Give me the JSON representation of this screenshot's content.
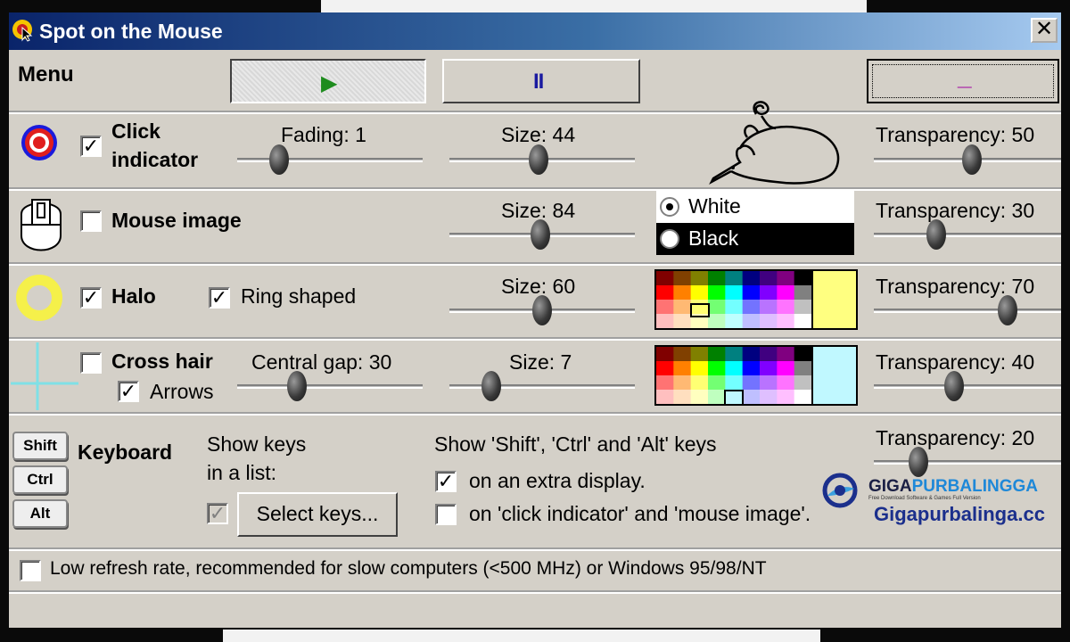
{
  "window": {
    "title": "Spot on the Mouse",
    "close_glyph": "✕"
  },
  "menu": {
    "label": "Menu",
    "play_glyph": "▶",
    "pause_glyph": "II",
    "minimize_glyph": "_"
  },
  "click_indicator": {
    "checked": true,
    "label_line1": "Click",
    "label_line2": "indicator",
    "fading_label": "Fading: 1",
    "fading_value": 1,
    "size_label": "Size: 44",
    "size_value": 44,
    "transparency_label": "Transparency: 50",
    "transparency_value": 50
  },
  "mouse_image": {
    "checked": false,
    "label": "Mouse image",
    "size_label": "Size: 84",
    "size_value": 84,
    "options": [
      "White",
      "Black"
    ],
    "selected": "White",
    "transparency_label": "Transparency: 30",
    "transparency_value": 30
  },
  "halo": {
    "checked": true,
    "label": "Halo",
    "ring_checked": true,
    "ring_label": "Ring shaped",
    "size_label": "Size: 60",
    "size_value": 60,
    "color": "#ffff80",
    "transparency_label": "Transparency: 70",
    "transparency_value": 70
  },
  "cross_hair": {
    "checked": false,
    "label": "Cross hair",
    "arrows_checked": true,
    "arrows_label": "Arrows",
    "gap_label": "Central gap: 30",
    "gap_value": 30,
    "size_label": "Size: 7",
    "size_value": 7,
    "color": "#c0f8ff",
    "transparency_label": "Transparency: 40",
    "transparency_value": 40
  },
  "keyboard": {
    "label": "Keyboard",
    "keys": [
      "Shift",
      "Ctrl",
      "Alt"
    ],
    "list_label_line1": "Show keys",
    "list_label_line2": "in a list:",
    "list_checked": true,
    "select_button": "Select keys...",
    "show_label": "Show 'Shift', 'Ctrl' and 'Alt' keys",
    "extra_display_checked": true,
    "extra_display_label": "on an extra display.",
    "on_indicator_checked": false,
    "on_indicator_label": "on 'click indicator' and 'mouse image'.",
    "transparency_label": "Transparency: 20",
    "transparency_value": 20
  },
  "low_refresh": {
    "checked": false,
    "label": "Low refresh rate, recommended for slow computers (<500 MHz) or Windows 95/98/NT"
  },
  "watermark": {
    "brand_part1": "GIGA",
    "brand_part2": "PURBALINGGA",
    "tagline": "Free Download Software & Games Full Version",
    "url": "Gigapurbalinga.cc"
  },
  "colors": {
    "play": "#1e8c1e",
    "pause": "#1a1aa0",
    "minimize": "#a000a0",
    "cross": "#7fe0e6",
    "halo_ring": "#f5f04a"
  }
}
